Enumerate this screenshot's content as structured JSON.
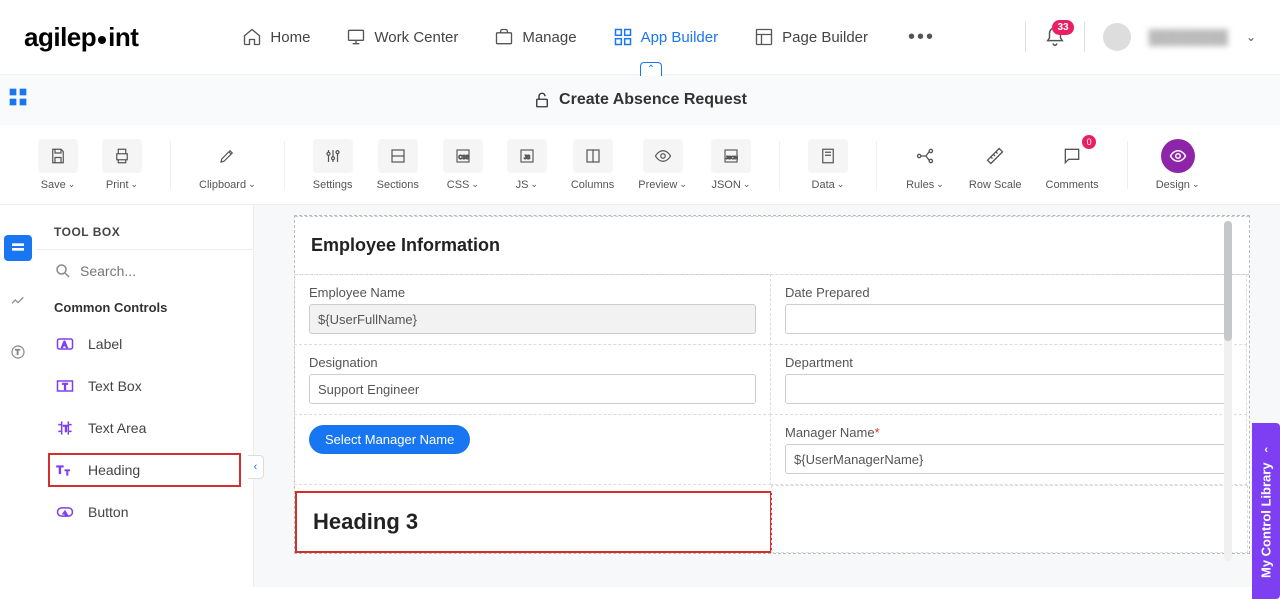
{
  "logo": "agilepoint",
  "nav": {
    "home": "Home",
    "workCenter": "Work Center",
    "manage": "Manage",
    "appBuilder": "App Builder",
    "pageBuilder": "Page Builder",
    "notifCount": "33",
    "userName": "████████"
  },
  "titleBar": {
    "title": "Create Absence Request"
  },
  "toolbar": {
    "save": "Save",
    "print": "Print",
    "clipboard": "Clipboard",
    "settings": "Settings",
    "sections": "Sections",
    "css": "CSS",
    "js": "JS",
    "columns": "Columns",
    "preview": "Preview",
    "json": "JSON",
    "data": "Data",
    "rules": "Rules",
    "rowScale": "Row Scale",
    "comments": "Comments",
    "commentCount": "0",
    "design": "Design"
  },
  "toolbox": {
    "title": "TOOL BOX",
    "searchPlaceholder": "Search...",
    "sectionTitle": "Common Controls",
    "items": {
      "label": "Label",
      "textBox": "Text Box",
      "textArea": "Text Area",
      "heading": "Heading",
      "button": "Button"
    }
  },
  "form": {
    "sectionTitle": "Employee Information",
    "employeeName": {
      "label": "Employee Name",
      "value": "${UserFullName}"
    },
    "datePrepared": {
      "label": "Date Prepared",
      "value": ""
    },
    "designation": {
      "label": "Designation",
      "value": "Support Engineer"
    },
    "department": {
      "label": "Department",
      "value": ""
    },
    "selectManager": "Select Manager Name",
    "managerName": {
      "label": "Manager Name",
      "value": "${UserManagerName}"
    },
    "headingDrop": "Heading 3"
  },
  "sideTab": "My Control Library"
}
